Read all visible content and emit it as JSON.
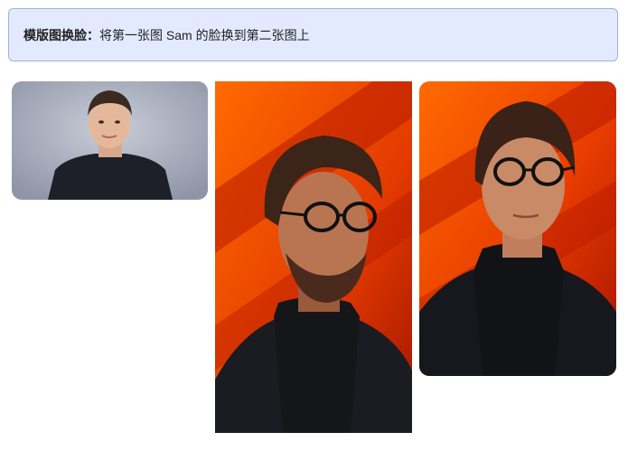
{
  "banner": {
    "label": "模版图换脸：",
    "text": "将第一张图 Sam 的脸换到第二张图上"
  },
  "images": [
    {
      "name": "source-face-photo",
      "description_icon": "portrait-photo-icon"
    },
    {
      "name": "template-photo",
      "description_icon": "portrait-photo-icon"
    },
    {
      "name": "result-photo",
      "description_icon": "portrait-photo-icon"
    }
  ],
  "colors": {
    "banner_bg": "#e3eaff",
    "banner_border": "#9fb2d9",
    "orange": "#ff5a00",
    "deep_red": "#a31200"
  }
}
